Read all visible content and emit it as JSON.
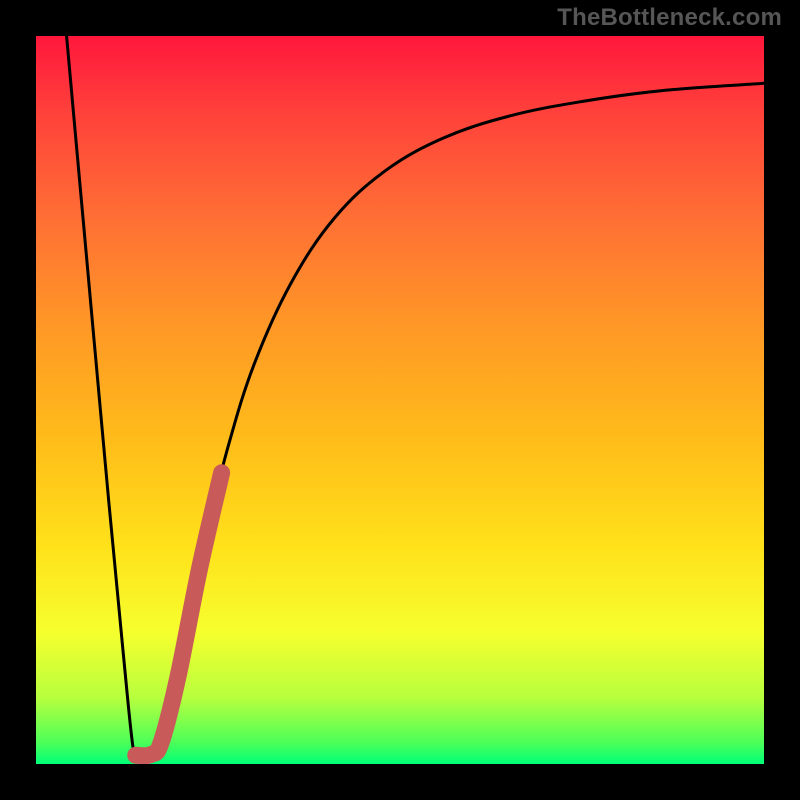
{
  "watermark": "TheBottleneck.com",
  "chart_data": {
    "type": "line",
    "title": "",
    "xlabel": "",
    "ylabel": "",
    "xlim": [
      0,
      100
    ],
    "ylim": [
      0,
      100
    ],
    "grid": false,
    "plot_background": {
      "type": "vertical-gradient",
      "stops": [
        {
          "pos": 0.0,
          "color": "#ff173c"
        },
        {
          "pos": 0.1,
          "color": "#ff3f3b"
        },
        {
          "pos": 0.25,
          "color": "#ff6f34"
        },
        {
          "pos": 0.4,
          "color": "#ff9826"
        },
        {
          "pos": 0.55,
          "color": "#ffbb1a"
        },
        {
          "pos": 0.7,
          "color": "#ffe11a"
        },
        {
          "pos": 0.82,
          "color": "#f6ff2e"
        },
        {
          "pos": 0.91,
          "color": "#b6ff3e"
        },
        {
          "pos": 0.97,
          "color": "#4dff58"
        },
        {
          "pos": 1.0,
          "color": "#00ff78"
        }
      ]
    },
    "series": [
      {
        "name": "bottleneck-curve",
        "style": "black-thin",
        "points": [
          {
            "x": 4.2,
            "y": 100.0
          },
          {
            "x": 6.0,
            "y": 80.0
          },
          {
            "x": 8.0,
            "y": 58.0
          },
          {
            "x": 10.0,
            "y": 36.0
          },
          {
            "x": 12.0,
            "y": 15.0
          },
          {
            "x": 13.3,
            "y": 2.5
          },
          {
            "x": 14.0,
            "y": 1.2
          },
          {
            "x": 15.5,
            "y": 1.3
          },
          {
            "x": 17.5,
            "y": 4.0
          },
          {
            "x": 19.0,
            "y": 10.0
          },
          {
            "x": 21.0,
            "y": 20.0
          },
          {
            "x": 23.5,
            "y": 32.0
          },
          {
            "x": 26.5,
            "y": 44.0
          },
          {
            "x": 30.0,
            "y": 55.0
          },
          {
            "x": 35.0,
            "y": 66.0
          },
          {
            "x": 41.0,
            "y": 75.0
          },
          {
            "x": 48.0,
            "y": 81.5
          },
          {
            "x": 56.0,
            "y": 86.0
          },
          {
            "x": 65.0,
            "y": 89.0
          },
          {
            "x": 75.0,
            "y": 91.0
          },
          {
            "x": 86.0,
            "y": 92.5
          },
          {
            "x": 100.0,
            "y": 93.5
          }
        ]
      },
      {
        "name": "highlight-segment",
        "style": "thick-red",
        "points": [
          {
            "x": 13.7,
            "y": 1.2
          },
          {
            "x": 15.8,
            "y": 1.3
          },
          {
            "x": 17.2,
            "y": 3.0
          },
          {
            "x": 19.5,
            "y": 12.0
          },
          {
            "x": 22.5,
            "y": 27.0
          },
          {
            "x": 25.5,
            "y": 40.0
          }
        ]
      }
    ]
  }
}
